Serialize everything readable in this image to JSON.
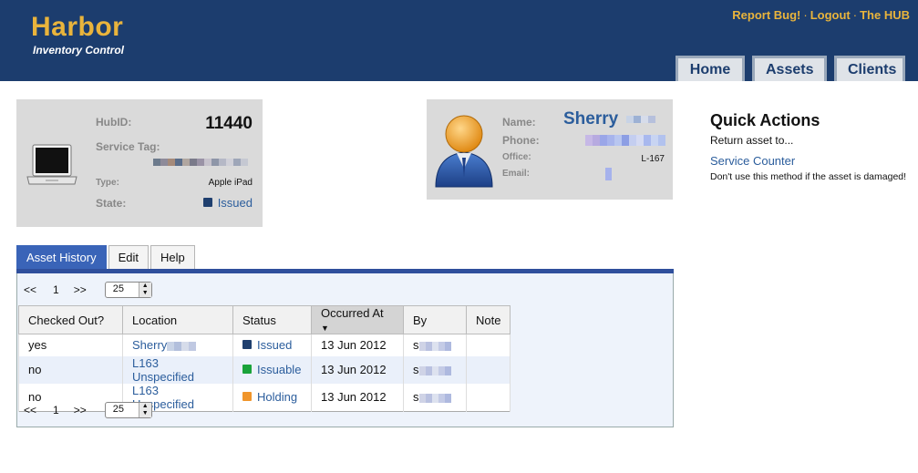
{
  "app": {
    "title": "Harbor",
    "subtitle": "Inventory Control"
  },
  "toplinks": [
    "Report Bug!",
    "Logout",
    "The HUB"
  ],
  "nav": [
    "Home",
    "Assets",
    "Clients"
  ],
  "asset": {
    "hubid_label": "HubID:",
    "hubid": "11440",
    "servicetag_label": "Service Tag:",
    "type_label": "Type:",
    "type": "Apple iPad",
    "state_label": "State:",
    "state": "Issued",
    "icon": "laptop-icon"
  },
  "person": {
    "name_label": "Name:",
    "name": "Sherry",
    "phone_label": "Phone:",
    "office_label": "Office:",
    "office": "L-167",
    "email_label": "Email:",
    "icon": "user-avatar-icon"
  },
  "quick": {
    "title": "Quick Actions",
    "return_text": "Return asset to...",
    "link": "Service Counter",
    "note": "Don't use this method if the asset is damaged!"
  },
  "tabs": [
    "Asset History",
    "Edit",
    "Help"
  ],
  "pager": {
    "first": "<<",
    "page": "1",
    "next": ">>",
    "per_page": "25"
  },
  "table": {
    "headers": [
      "Checked Out?",
      "Location",
      "Status",
      "Occurred At",
      "By",
      "Note"
    ],
    "rows": [
      {
        "checked": "yes",
        "location": "Sherry",
        "status": "Issued",
        "status_color": "#1f3f6e",
        "date": "13 Jun 2012",
        "by": "s",
        "note": ""
      },
      {
        "checked": "no",
        "location": "L163 Unspecified",
        "status": "Issuable",
        "status_color": "#1aa33a",
        "date": "13 Jun 2012",
        "by": "s",
        "note": ""
      },
      {
        "checked": "no",
        "location": "L163 Unspecified",
        "status": "Holding",
        "status_color": "#f0952b",
        "date": "13 Jun 2012",
        "by": "s",
        "note": ""
      }
    ]
  },
  "colors": {
    "header_bg": "#1c3d6e",
    "brand_gold": "#e9b43c",
    "link_blue": "#2b5d9c",
    "tab_active": "#3a64b8"
  }
}
